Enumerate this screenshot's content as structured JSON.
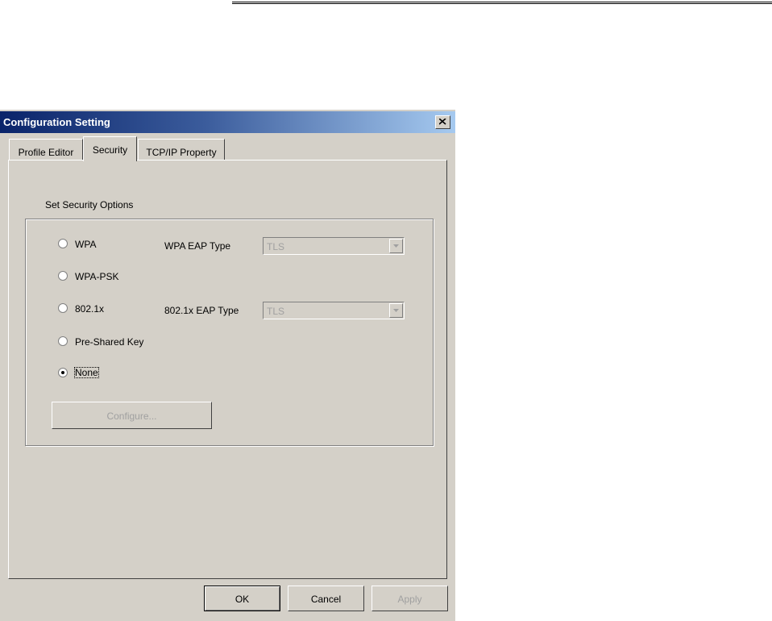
{
  "window": {
    "title": "Configuration Setting"
  },
  "tabs": [
    {
      "label": "Profile Editor"
    },
    {
      "label": "Security"
    },
    {
      "label": "TCP/IP Property"
    }
  ],
  "security": {
    "group_label": "Set Security Options",
    "options": [
      {
        "label": "WPA",
        "selected": false
      },
      {
        "label": "WPA-PSK",
        "selected": false
      },
      {
        "label": "802.1x",
        "selected": false
      },
      {
        "label": "Pre-Shared Key",
        "selected": false
      },
      {
        "label": "None",
        "selected": true
      }
    ],
    "wpa_eap_type": {
      "label": "WPA EAP Type",
      "value": "TLS"
    },
    "dot1x_eap_type": {
      "label": "802.1x EAP Type",
      "value": "TLS"
    },
    "configure_label": "Configure..."
  },
  "buttons": {
    "ok": "OK",
    "cancel": "Cancel",
    "apply": "Apply"
  }
}
